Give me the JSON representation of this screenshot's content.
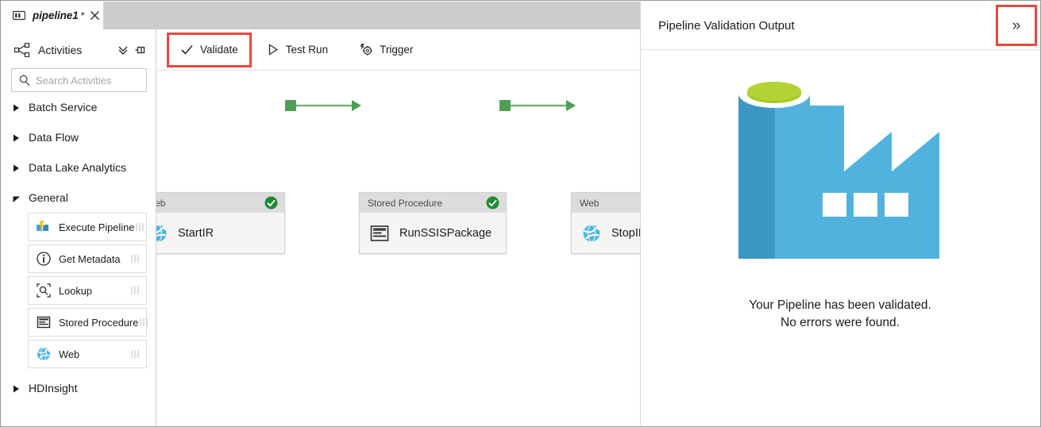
{
  "window": {
    "tab": {
      "icon": "pipeline-icon",
      "label": "pipeline1",
      "dirty_marker": "*",
      "close_icon": "close-icon"
    }
  },
  "activities_pane": {
    "header": {
      "icon": "activities-network-icon",
      "title": "Activities",
      "collapse_all_icon": "double-chevron-down-icon",
      "pin_icon": "pin-icon"
    },
    "search": {
      "icon": "search-icon",
      "placeholder": "Search Activities",
      "value": ""
    },
    "categories": [
      {
        "label": "Batch Service",
        "expanded": false
      },
      {
        "label": "Data Flow",
        "expanded": false
      },
      {
        "label": "Data Lake Analytics",
        "expanded": false
      },
      {
        "label": "General",
        "expanded": true
      },
      {
        "label": "HDInsight",
        "expanded": false
      }
    ],
    "general_items": [
      {
        "label": "Execute Pipeline",
        "icon": "execute-pipeline-icon"
      },
      {
        "label": "Get Metadata",
        "icon": "get-metadata-icon"
      },
      {
        "label": "Lookup",
        "icon": "lookup-icon"
      },
      {
        "label": "Stored Procedure",
        "icon": "stored-procedure-icon"
      },
      {
        "label": "Web",
        "icon": "web-icon"
      }
    ]
  },
  "toolbar": {
    "validate": {
      "label": "Validate",
      "icon": "checkmark-icon",
      "highlighted": true
    },
    "test_run": {
      "label": "Test Run",
      "icon": "play-icon"
    },
    "trigger": {
      "label": "Trigger",
      "icon": "trigger-gear-icon"
    }
  },
  "canvas": {
    "nodes": [
      {
        "type": "Web",
        "name": "StartIR",
        "icon": "web-icon",
        "status": "valid"
      },
      {
        "type": "Stored Procedure",
        "name": "RunSSISPackage",
        "icon": "stored-procedure-icon",
        "status": "valid"
      },
      {
        "type": "Web",
        "name": "StopIR",
        "icon": "web-icon",
        "status": "valid"
      }
    ]
  },
  "validation_panel": {
    "title": "Pipeline Validation Output",
    "expand_button": {
      "icon": "double-chevron-right-icon",
      "glyph": "»",
      "highlighted": true
    },
    "illustration": "factory-icon",
    "message_line1": "Your Pipeline has been validated.",
    "message_line2": "No errors were found."
  },
  "colors": {
    "highlight_red": "#e8483e",
    "success_green": "#1e8c2e",
    "connector_green": "#4f9e56",
    "factory_blue": "#51b3dd",
    "factory_blue_dark": "#3b98c4",
    "factory_green": "#a4c822",
    "tabstrip_gray": "#cccccc",
    "node_header_gray": "#dcdcdc"
  }
}
